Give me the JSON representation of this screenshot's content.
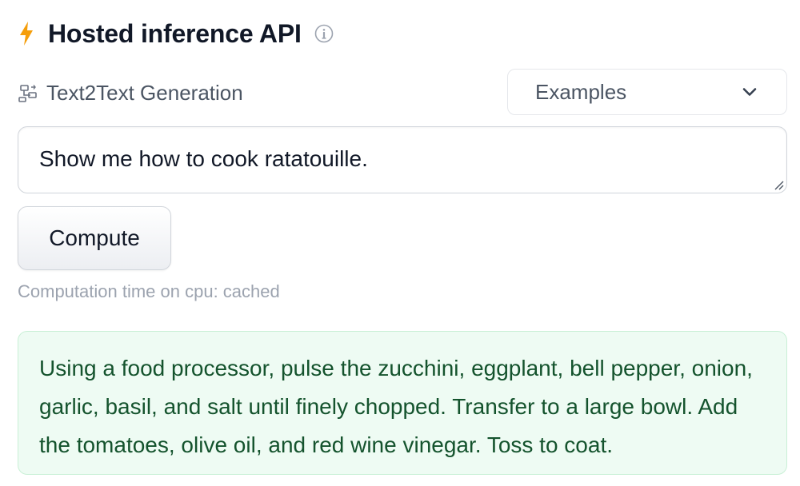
{
  "header": {
    "title": "Hosted inference API",
    "icons": {
      "bolt": "lightning-icon",
      "info": "info-icon"
    },
    "accent": "#f59e0b"
  },
  "task": {
    "label": "Text2Text Generation",
    "icon": "text2text-generation-icon"
  },
  "examples": {
    "label": "Examples",
    "icon": "chevron-down-icon"
  },
  "input": {
    "value": "Show me how to cook ratatouille."
  },
  "compute_button": {
    "label": "Compute"
  },
  "status": {
    "computation_time": "Computation time on cpu: cached"
  },
  "output": {
    "text": "Using a food processor, pulse the zucchini, eggplant, bell pepper, onion, garlic, basil, and salt until finely chopped. Transfer to a large bowl. Add the tomatoes, olive oil, and red wine vinegar. Toss to coat."
  },
  "colors": {
    "output_background": "#eefbf3",
    "output_border": "#c9f0d6",
    "output_text": "#14532d"
  }
}
